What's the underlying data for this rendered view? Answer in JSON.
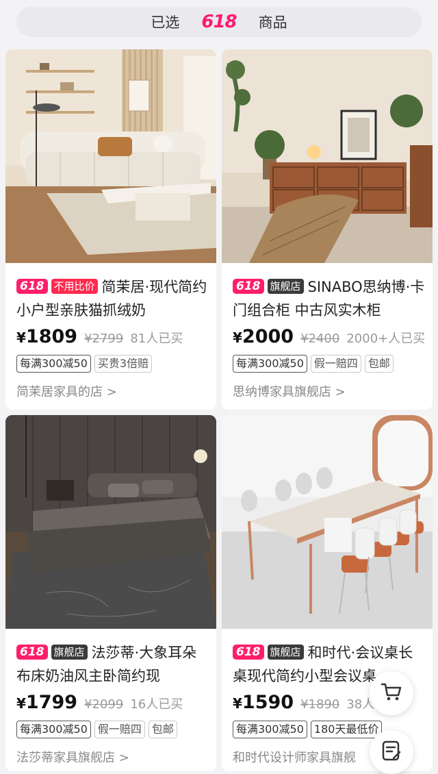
{
  "header": {
    "prefix": "已选",
    "logo": "618",
    "suffix": "商品"
  },
  "products": [
    {
      "badge": "618",
      "tag_label": "不用比价",
      "title": "简茉居·现代简约小户型亲肤猫抓绒奶",
      "currency": "¥",
      "price": "1809",
      "original_price": "¥2799",
      "sold": "81人已买",
      "tags": [
        "每满300减50",
        "买贵3倍赔"
      ],
      "shop": "简茉居家具的店 >"
    },
    {
      "badge": "618",
      "tag_label": "旗舰店",
      "title": "SINABO思纳博·卡门组合柜 中古风实木柜",
      "currency": "¥",
      "price": "2000",
      "original_price": "¥2400",
      "sold": "2000+人已买",
      "tags": [
        "每满300减50",
        "假一赔四",
        "包邮"
      ],
      "shop": "思纳博家具旗舰店 >"
    },
    {
      "badge": "618",
      "tag_label": "旗舰店",
      "title": "法莎蒂·大象耳朵布床奶油风主卧简约现",
      "currency": "¥",
      "price": "1799",
      "original_price": "¥2099",
      "sold": "16人已买",
      "tags": [
        "每满300减50",
        "假一赔四",
        "包邮"
      ],
      "shop": "法莎蒂家具旗舰店 >"
    },
    {
      "badge": "618",
      "tag_label": "旗舰店",
      "title": "和时代·会议桌长桌现代简约小型会议桌",
      "currency": "¥",
      "price": "1590",
      "original_price": "¥1890",
      "sold": "38人",
      "tags": [
        "每满300减50",
        "180天最低价"
      ],
      "shop": "和时代设计师家具旗舰"
    }
  ],
  "floating": {
    "cart_icon": "cart-icon",
    "notes_icon": "notes-icon"
  },
  "colors": {
    "accent": "#ff1f68",
    "badge_red": "#ff2b4f",
    "badge_dark": "#3a3a3a"
  }
}
